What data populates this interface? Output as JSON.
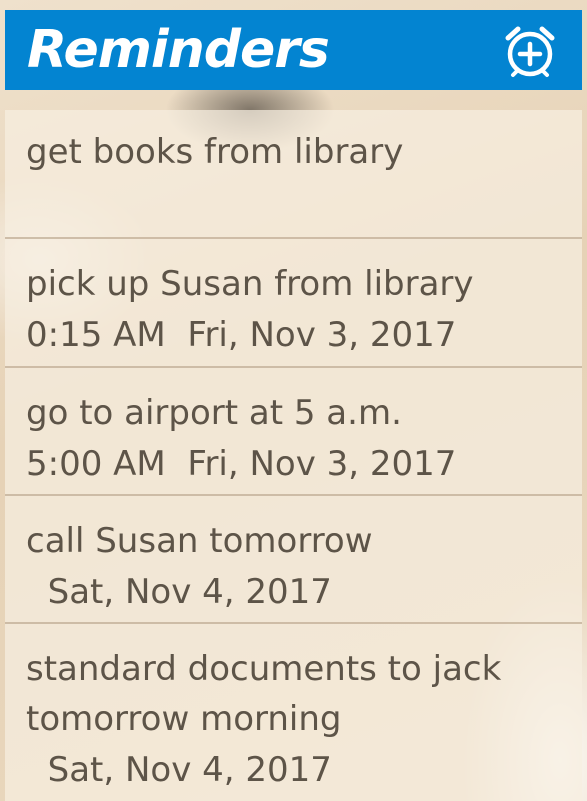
{
  "app": {
    "title": "Reminders",
    "add_icon": "alarm-add-icon",
    "header_color": "#0384d1"
  },
  "reminders": [
    {
      "text": [
        "get books from library"
      ],
      "when": ""
    },
    {
      "text": [
        "pick up Susan from library"
      ],
      "when": "0:15 AM  Fri, Nov 3, 2017"
    },
    {
      "text": [
        "go to airport at 5 a.m."
      ],
      "when": "5:00 AM  Fri, Nov 3, 2017"
    },
    {
      "text": [
        "call Susan tomorrow"
      ],
      "when": "  Sat, Nov 4, 2017"
    },
    {
      "text": [
        "standard documents to jack",
        "tomorrow morning"
      ],
      "when": "  Sat, Nov 4, 2017"
    }
  ]
}
